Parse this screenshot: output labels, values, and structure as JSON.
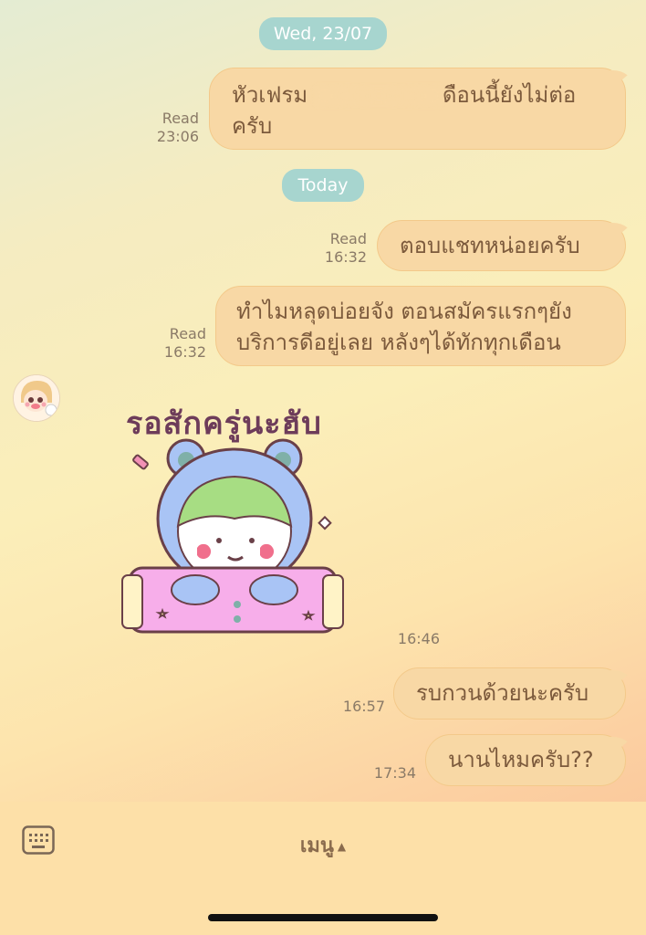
{
  "chat": {
    "date_separators": [
      "Wed, 23/07",
      "Today"
    ],
    "messages": [
      {
        "line1": "หัวเฟรม",
        "line1_end": "ดือนนี้ยังไม่ต่อ",
        "line2": "ครับ",
        "read": "Read",
        "time": "23:06"
      },
      {
        "text": "ตอบแชทหน่อยครับ",
        "read": "Read",
        "time": "16:32"
      },
      {
        "line1": "ทำไมหลุดบ่อยจัง ตอนสมัครแรกๆยัง",
        "line2": "บริการดีอยู่เลย หลังๆได้ทักทุกเดือน",
        "read": "Read",
        "time": "16:32"
      },
      {
        "text": "รบกวนด้วยนะครับ",
        "time": "16:57"
      },
      {
        "text": "นานไหมครับ??",
        "time": "17:34"
      }
    ],
    "sticker": {
      "caption": "รอสักครู่นะฮับ",
      "time": "16:46"
    }
  },
  "footer": {
    "menu_label": "เมนู",
    "caret": "▲"
  },
  "colors": {
    "bubble": "#f8d8a5",
    "bubble_text": "#7c5a3c",
    "date_pill": "#a7d5cf",
    "footer": "#fde0a8"
  },
  "icons": [
    "keyboard-icon",
    "caret-up-icon",
    "avatar-image"
  ]
}
